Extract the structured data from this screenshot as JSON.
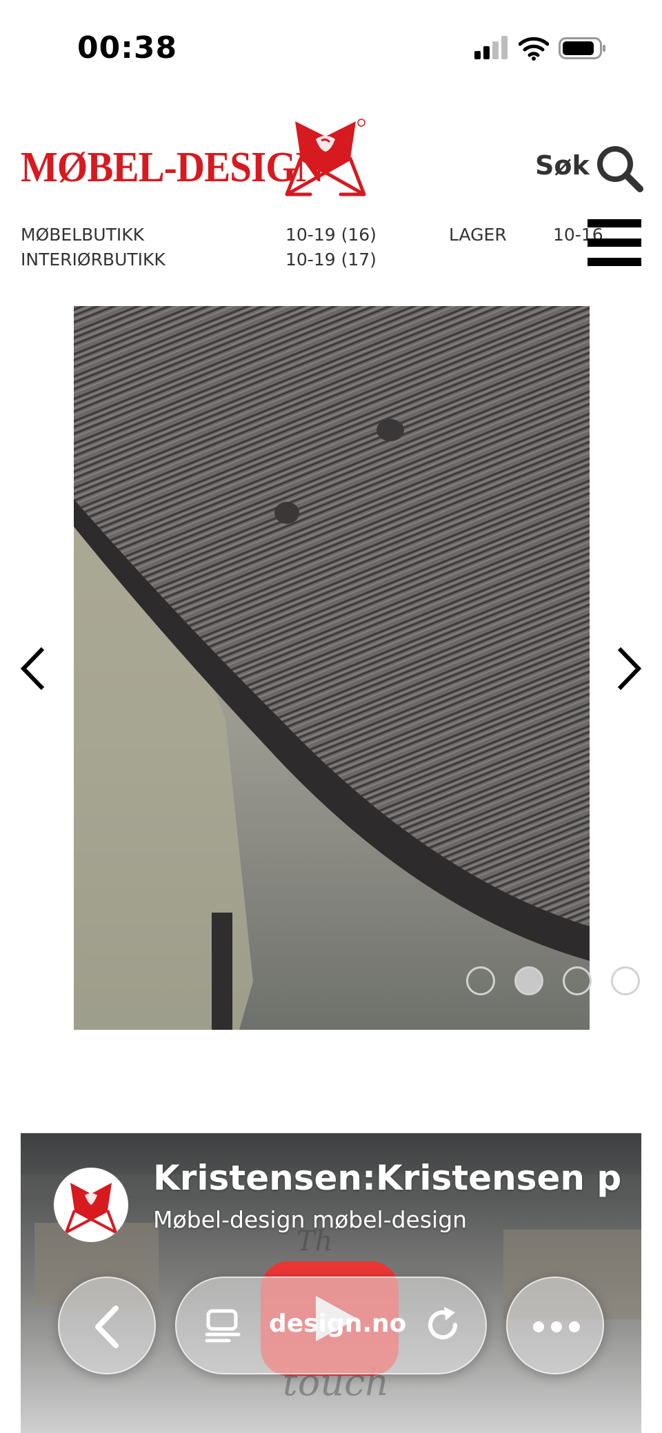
{
  "status_bar": {
    "time": "00:38"
  },
  "header": {
    "brand": "MØBEL-DESIGN",
    "search_label": "Søk"
  },
  "hours": {
    "row1": {
      "label": "MØBELBUTIKK",
      "hours": "10-19 (16)",
      "label2": "LAGER",
      "hours2": "10-16"
    },
    "row2": {
      "label": "INTERIØRBUTIKK",
      "hours": "10-19 (17)"
    }
  },
  "carousel": {
    "slide_count": 4,
    "active_slide": 2
  },
  "video": {
    "title": "Kristensen:Kristensen pres",
    "channel": "Møbel-design møbel-design"
  },
  "browser": {
    "url": "design.no"
  },
  "colors": {
    "brand_red": "#d71920",
    "text": "#333333"
  }
}
